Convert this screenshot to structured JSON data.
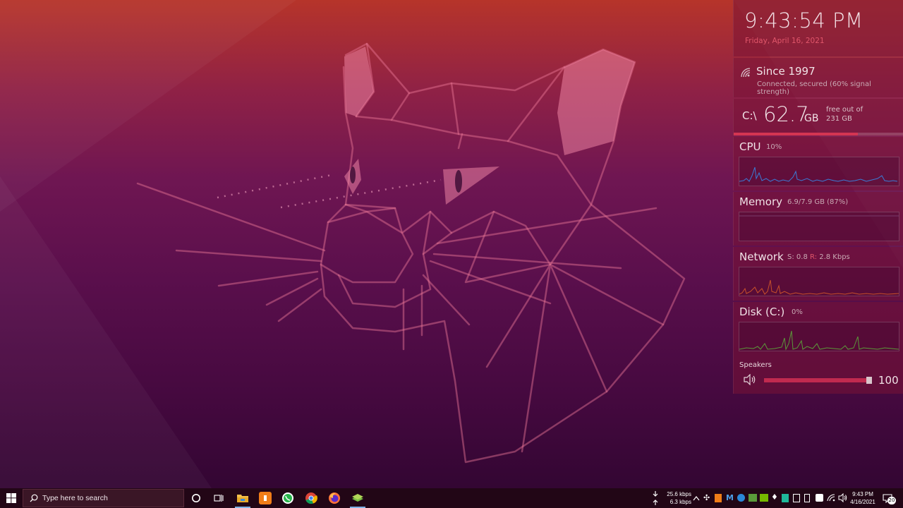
{
  "clock": {
    "time": "9:43:54 PM",
    "date": "Friday, April 16, 2021"
  },
  "wifi": {
    "name": "Since 1997",
    "status": "Connected, secured (60% signal strength)",
    "icon": "wifi-icon"
  },
  "disk": {
    "drive": "C:\\",
    "free_value": "62.7",
    "unit": "GB",
    "free_label": "free out of",
    "total": "231 GB",
    "used_fraction": 0.73
  },
  "cpu": {
    "title": "CPU",
    "value": "10%"
  },
  "memory": {
    "title": "Memory",
    "value": "6.9/7.9 GB (87%)"
  },
  "network": {
    "title": "Network",
    "s_label": "S:",
    "s_value": "0.8",
    "r_label": "R:",
    "r_value": "2.8 Kbps"
  },
  "diskio": {
    "title": "Disk (C:)",
    "value": "0%"
  },
  "volume": {
    "label": "Speakers",
    "value": "100",
    "level": 1.0
  },
  "taskbar": {
    "search_placeholder": "Type here to search",
    "net_up": "25.6 kbps",
    "net_down": "6.3 kbps",
    "time": "9:43 PM",
    "date": "4/16/2021",
    "notifications": "20"
  },
  "colors": {
    "accent": "#d43552",
    "cpu_line": "#3a7bd5",
    "net_line": "#c8502a",
    "disk_line": "#5b9a3a"
  }
}
